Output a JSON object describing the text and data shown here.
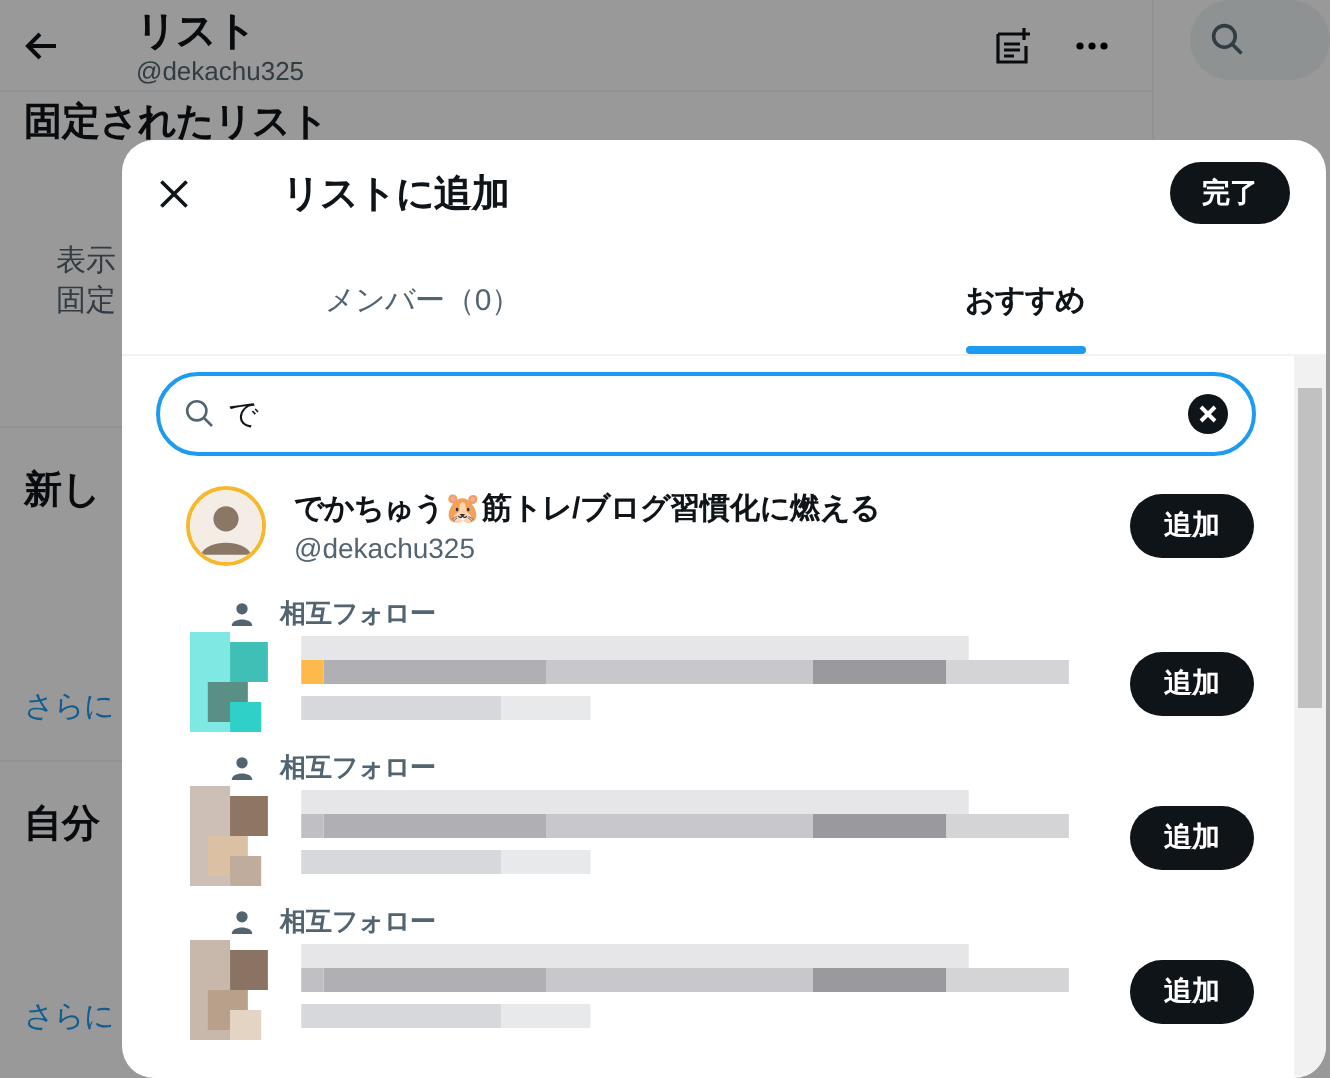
{
  "page": {
    "title": "リスト",
    "handle": "@dekachu325",
    "sections": [
      {
        "title": "固定されたリスト",
        "lines": [
          "表示",
          "固定"
        ]
      },
      {
        "title": "新し",
        "link": "さらに"
      },
      {
        "title": "自分",
        "link": "さらに"
      }
    ]
  },
  "dialog": {
    "title": "リストに追加",
    "done": "完了",
    "tabs": [
      {
        "label": "メンバー（0）",
        "selected": false
      },
      {
        "label": "おすすめ",
        "selected": true
      }
    ],
    "search": {
      "value": "で"
    },
    "results": [
      {
        "kind": "account",
        "name": "でかちゅう🐹筋トレ/ブログ習慣化に燃える",
        "handle": "@dekachu325",
        "button": "追加"
      },
      {
        "kind": "mutual",
        "context": "相互フォロー",
        "button": "追加"
      },
      {
        "kind": "mutual",
        "context": "相互フォロー",
        "button": "追加"
      },
      {
        "kind": "mutual",
        "context": "相互フォロー",
        "button": "追加"
      }
    ]
  }
}
